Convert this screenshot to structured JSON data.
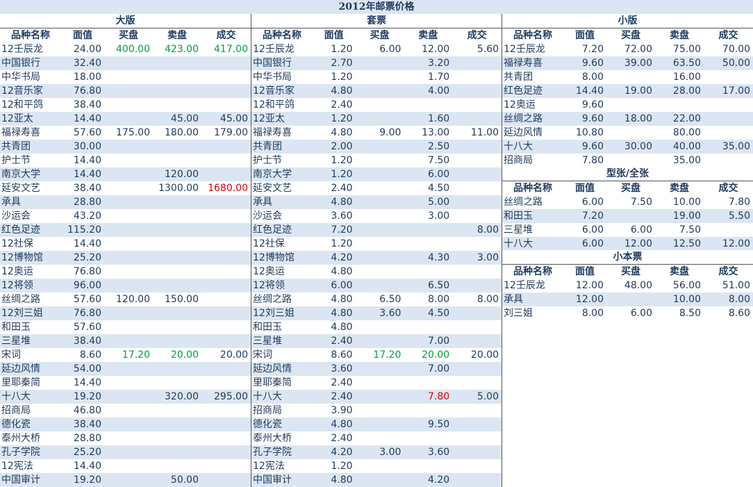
{
  "page_title": "2012年邮票价格",
  "headers": [
    "品种名称",
    "面值",
    "买盘",
    "卖盘",
    "成交"
  ],
  "colors": {
    "green": "#00a03c",
    "red": "#e00000",
    "stripe": "#dce6f2",
    "text": "#1e3a5f"
  },
  "sections": {
    "daban": {
      "title": "大版",
      "rows": [
        [
          "12壬辰龙",
          "24.00",
          "400.00",
          "423.00",
          "417.00"
        ],
        [
          "中国银行",
          "32.40",
          "",
          "",
          ""
        ],
        [
          "中华书局",
          "18.00",
          "",
          "",
          ""
        ],
        [
          "12音乐家",
          "76.80",
          "",
          "",
          ""
        ],
        [
          "12和平鸽",
          "38.40",
          "",
          "",
          ""
        ],
        [
          "12亚太",
          "14.40",
          "",
          "45.00",
          "45.00"
        ],
        [
          "福禄寿喜",
          "57.60",
          "175.00",
          "180.00",
          "179.00"
        ],
        [
          "共青团",
          "30.00",
          "",
          "",
          ""
        ],
        [
          "护士节",
          "14.40",
          "",
          "",
          ""
        ],
        [
          "南京大学",
          "14.40",
          "",
          "120.00",
          ""
        ],
        [
          "延安文艺",
          "38.40",
          "",
          "1300.00",
          "1680.00"
        ],
        [
          "承具",
          "28.80",
          "",
          "",
          ""
        ],
        [
          "沙运会",
          "43.20",
          "",
          "",
          ""
        ],
        [
          "红色足迹",
          "115.20",
          "",
          "",
          ""
        ],
        [
          "12社保",
          "14.40",
          "",
          "",
          ""
        ],
        [
          "12博物馆",
          "25.20",
          "",
          "",
          ""
        ],
        [
          "12奥运",
          "76.80",
          "",
          "",
          ""
        ],
        [
          "12将领",
          "96.00",
          "",
          "",
          ""
        ],
        [
          "丝绸之路",
          "57.60",
          "120.00",
          "150.00",
          ""
        ],
        [
          "12刘三姐",
          "76.80",
          "",
          "",
          ""
        ],
        [
          "和田玉",
          "57.60",
          "",
          "",
          ""
        ],
        [
          "三星堆",
          "38.40",
          "",
          "",
          ""
        ],
        [
          "宋词",
          "8.60",
          "17.20",
          "20.00",
          "20.00"
        ],
        [
          "延边风情",
          "54.00",
          "",
          "",
          ""
        ],
        [
          "里耶秦简",
          "14.40",
          "",
          "",
          ""
        ],
        [
          "十八大",
          "19.20",
          "",
          "320.00",
          "295.00"
        ],
        [
          "招商局",
          "46.80",
          "",
          "",
          ""
        ],
        [
          "德化瓷",
          "38.40",
          "",
          "",
          ""
        ],
        [
          "泰州大桥",
          "28.80",
          "",
          "",
          ""
        ],
        [
          "孔子学院",
          "25.20",
          "",
          "",
          ""
        ],
        [
          "12宪法",
          "14.40",
          "",
          "",
          ""
        ],
        [
          "中国审计",
          "19.20",
          "",
          "50.00",
          ""
        ]
      ],
      "highlights": [
        {
          "row": 0,
          "col": 2,
          "color": "green"
        },
        {
          "row": 0,
          "col": 3,
          "color": "green"
        },
        {
          "row": 0,
          "col": 4,
          "color": "green"
        },
        {
          "row": 10,
          "col": 4,
          "color": "red"
        },
        {
          "row": 22,
          "col": 2,
          "color": "green"
        },
        {
          "row": 22,
          "col": 3,
          "color": "green"
        }
      ]
    },
    "taopiao": {
      "title": "套票",
      "rows": [
        [
          "12壬辰龙",
          "1.20",
          "6.00",
          "12.00",
          "5.60"
        ],
        [
          "中国银行",
          "2.70",
          "",
          "3.20",
          ""
        ],
        [
          "中华书局",
          "1.20",
          "",
          "1.70",
          ""
        ],
        [
          "12音乐家",
          "4.80",
          "",
          "4.00",
          ""
        ],
        [
          "12和平鸽",
          "2.40",
          "",
          "",
          ""
        ],
        [
          "12亚太",
          "1.20",
          "",
          "1.60",
          ""
        ],
        [
          "福禄寿喜",
          "4.80",
          "9.00",
          "13.00",
          "11.00"
        ],
        [
          "共青团",
          "2.00",
          "",
          "2.50",
          ""
        ],
        [
          "护士节",
          "1.20",
          "",
          "7.50",
          ""
        ],
        [
          "南京大学",
          "1.20",
          "",
          "6.00",
          ""
        ],
        [
          "延安文艺",
          "2.40",
          "",
          "4.50",
          ""
        ],
        [
          "承具",
          "4.80",
          "",
          "5.00",
          ""
        ],
        [
          "沙运会",
          "3.60",
          "",
          "3.00",
          ""
        ],
        [
          "红色足迹",
          "7.20",
          "",
          "",
          "8.00"
        ],
        [
          "12社保",
          "1.20",
          "",
          "",
          ""
        ],
        [
          "12博物馆",
          "4.20",
          "",
          "4.30",
          "3.00"
        ],
        [
          "12奥运",
          "4.80",
          "",
          "",
          ""
        ],
        [
          "12将领",
          "6.00",
          "",
          "6.50",
          ""
        ],
        [
          "丝绸之路",
          "4.80",
          "6.50",
          "8.00",
          "8.00"
        ],
        [
          "12刘三姐",
          "4.80",
          "3.60",
          "4.50",
          ""
        ],
        [
          "和田玉",
          "4.80",
          "",
          "",
          ""
        ],
        [
          "三星堆",
          "2.40",
          "",
          "7.00",
          ""
        ],
        [
          "宋词",
          "8.60",
          "17.20",
          "20.00",
          "20.00"
        ],
        [
          "延边风情",
          "3.60",
          "",
          "7.00",
          ""
        ],
        [
          "里耶秦简",
          "2.40",
          "",
          "",
          ""
        ],
        [
          "十八大",
          "2.40",
          "",
          "7.80",
          "5.00"
        ],
        [
          "招商局",
          "3.90",
          "",
          "",
          ""
        ],
        [
          "德化瓷",
          "4.80",
          "",
          "9.50",
          ""
        ],
        [
          "泰州大桥",
          "2.40",
          "",
          "",
          ""
        ],
        [
          "孔子学院",
          "4.20",
          "3.00",
          "3.60",
          ""
        ],
        [
          "12宪法",
          "1.20",
          "",
          "",
          ""
        ],
        [
          "中国审计",
          "4.80",
          "",
          "4.20",
          ""
        ]
      ],
      "highlights": [
        {
          "row": 22,
          "col": 2,
          "color": "green"
        },
        {
          "row": 22,
          "col": 3,
          "color": "green"
        },
        {
          "row": 25,
          "col": 3,
          "color": "red"
        }
      ]
    },
    "xiaoban": {
      "title": "小版",
      "rows": [
        [
          "12壬辰龙",
          "7.20",
          "72.00",
          "75.00",
          "70.00"
        ],
        [
          "福禄寿喜",
          "9.60",
          "39.00",
          "63.50",
          "50.00"
        ],
        [
          "共青团",
          "8.00",
          "",
          "16.00",
          ""
        ],
        [
          "红色足迹",
          "14.40",
          "19.00",
          "28.00",
          "17.00"
        ],
        [
          "12奥运",
          "9.60",
          "",
          "",
          ""
        ],
        [
          "丝绸之路",
          "9.60",
          "18.00",
          "22.00",
          ""
        ],
        [
          "延边风情",
          "10.80",
          "",
          "80.00",
          ""
        ],
        [
          "十八大",
          "9.60",
          "30.00",
          "40.00",
          "35.00"
        ],
        [
          "招商局",
          "7.80",
          "",
          "35.00",
          ""
        ]
      ],
      "highlights": []
    },
    "xingzhang": {
      "title": "型张/全张",
      "rows": [
        [
          "丝绸之路",
          "6.00",
          "7.50",
          "10.00",
          "7.80"
        ],
        [
          "和田玉",
          "7.20",
          "",
          "19.00",
          "5.50"
        ],
        [
          "三星堆",
          "6.00",
          "6.00",
          "7.50",
          ""
        ],
        [
          "十八大",
          "6.00",
          "12.00",
          "12.50",
          "12.00"
        ]
      ],
      "highlights": []
    },
    "xiaobenpiao": {
      "title": "小本票",
      "rows": [
        [
          "12壬辰龙",
          "12.00",
          "48.00",
          "56.00",
          "51.00"
        ],
        [
          "承具",
          "12.00",
          "",
          "10.00",
          "8.00"
        ],
        [
          "刘三姐",
          "8.00",
          "6.00",
          "8.50",
          "8.60"
        ]
      ],
      "highlights": []
    }
  }
}
